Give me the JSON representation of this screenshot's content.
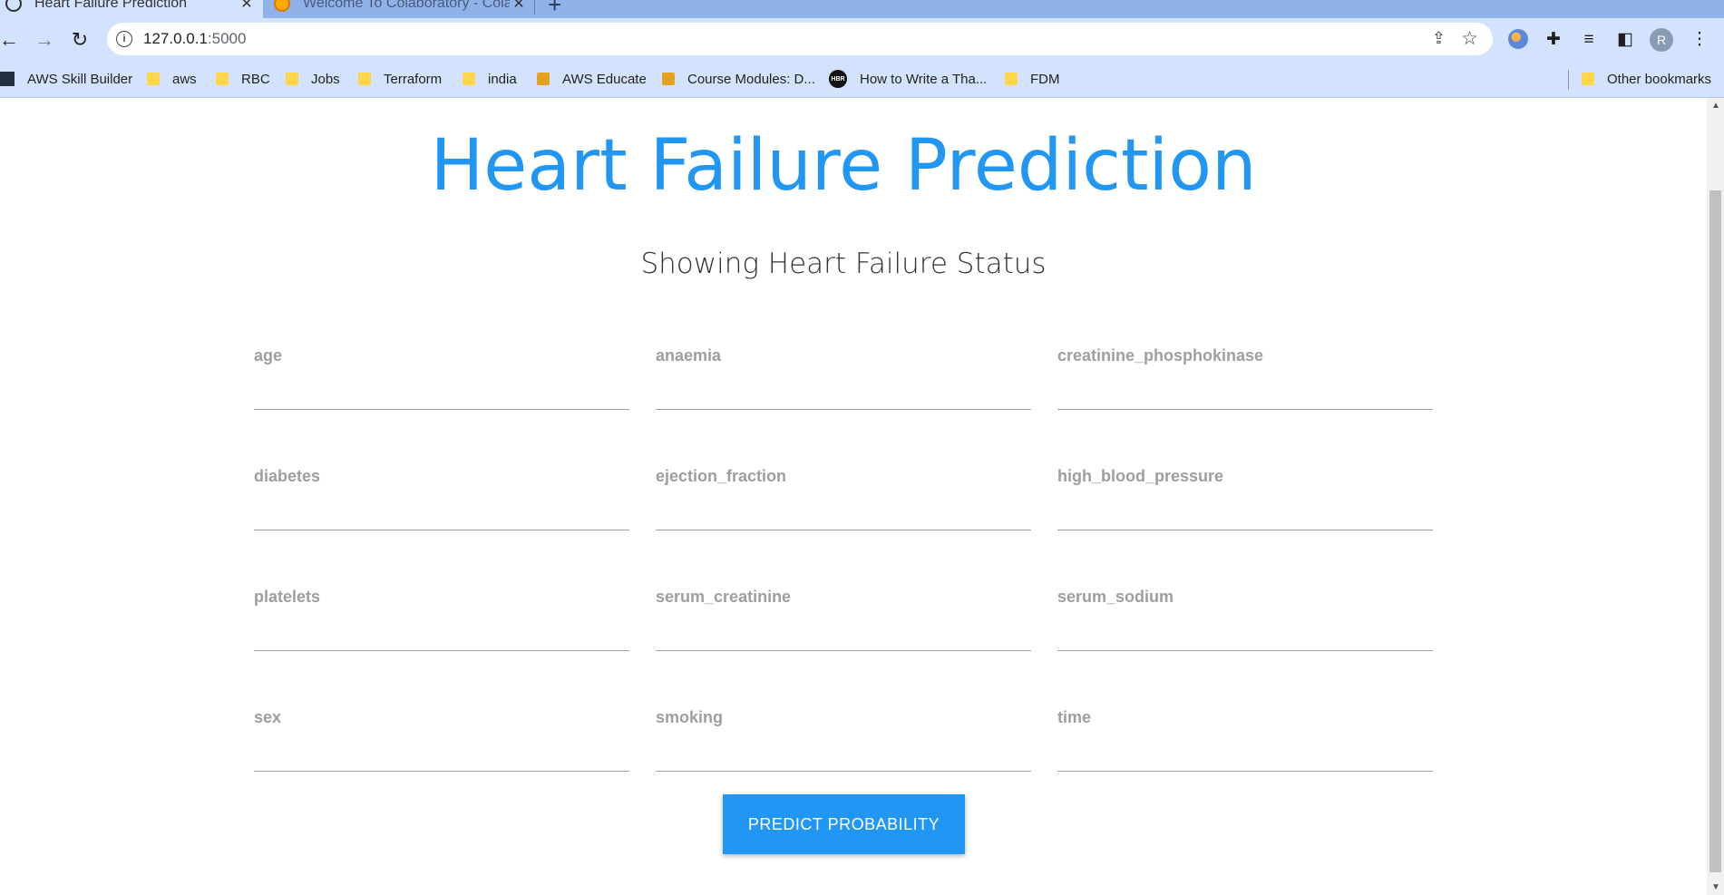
{
  "browser": {
    "tabs": [
      {
        "title": "Heart Failure Prediction"
      },
      {
        "title": "Welcome To Colaboratory - Colab"
      }
    ],
    "url_host": "127.0.0.1",
    "url_port": ":5000",
    "avatar_letter": "R",
    "bookmarks": [
      {
        "label": "AWS Skill Builder",
        "icon": "aws-logo-icon"
      },
      {
        "label": "aws",
        "icon": "folder-icon"
      },
      {
        "label": "RBC",
        "icon": "folder-icon"
      },
      {
        "label": "Jobs",
        "icon": "folder-icon"
      },
      {
        "label": "Terraform",
        "icon": "folder-icon"
      },
      {
        "label": "india",
        "icon": "folder-icon"
      },
      {
        "label": "AWS Educate",
        "icon": "box-icon"
      },
      {
        "label": "Course Modules: D...",
        "icon": "box-icon"
      },
      {
        "label": "How to Write a Tha...",
        "icon": "hbr-icon"
      },
      {
        "label": "FDM",
        "icon": "folder-icon"
      }
    ],
    "other_bookmarks": "Other bookmarks",
    "hbr_text": "HBR"
  },
  "page": {
    "title": "Heart Failure Prediction",
    "subtitle": "Showing Heart Failure Status",
    "fields": [
      {
        "label": "age",
        "value": ""
      },
      {
        "label": "anaemia",
        "value": ""
      },
      {
        "label": "creatinine_phosphokinase",
        "value": ""
      },
      {
        "label": "diabetes",
        "value": ""
      },
      {
        "label": "ejection_fraction",
        "value": ""
      },
      {
        "label": "high_blood_pressure",
        "value": ""
      },
      {
        "label": "platelets",
        "value": ""
      },
      {
        "label": "serum_creatinine",
        "value": ""
      },
      {
        "label": "serum_sodium",
        "value": ""
      },
      {
        "label": "sex",
        "value": ""
      },
      {
        "label": "smoking",
        "value": ""
      },
      {
        "label": "time",
        "value": ""
      }
    ],
    "predict_button": "PREDICT PROBABILITY"
  },
  "colors": {
    "accent": "#2196f3",
    "chrome": "#d3e3fd",
    "tabstrip": "#8fb2ea",
    "label": "#9e9e9e"
  }
}
